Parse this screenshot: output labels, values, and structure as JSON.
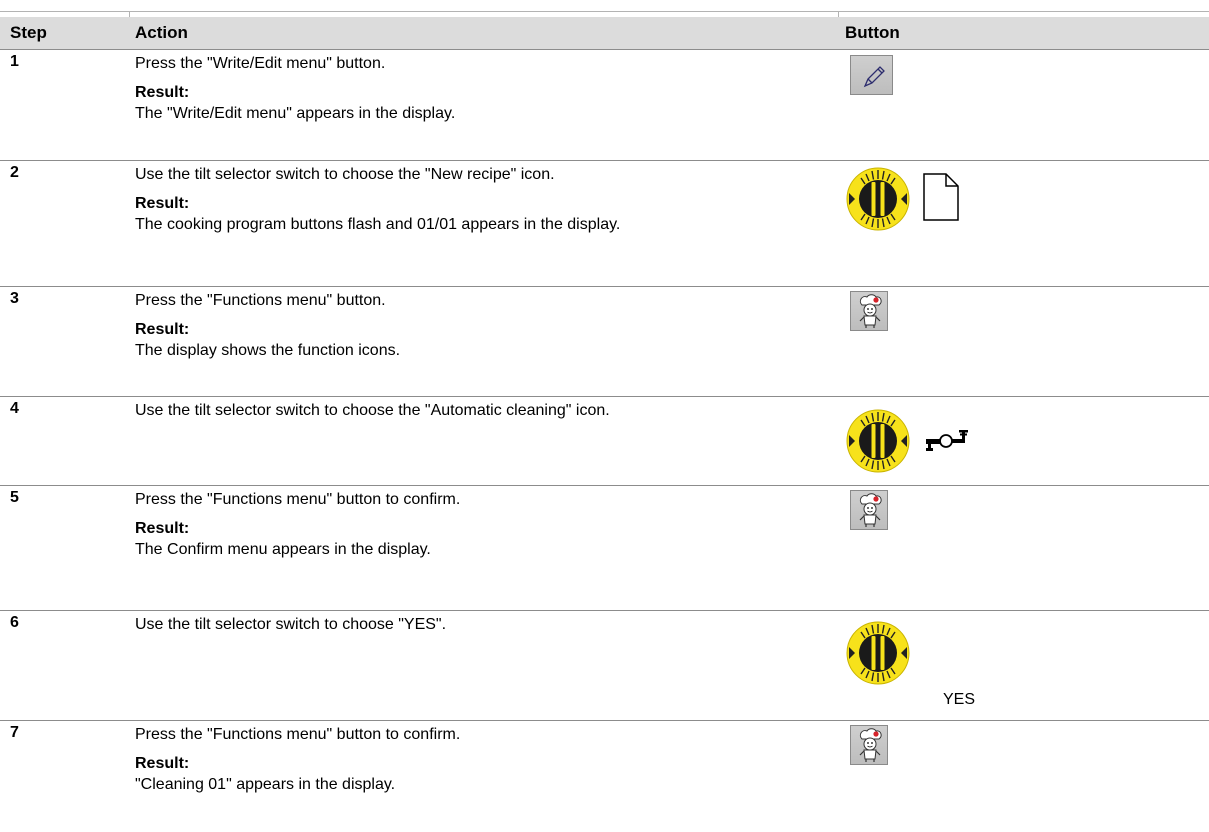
{
  "table": {
    "headers": {
      "step": "Step",
      "action": "Action",
      "button": "Button"
    },
    "rows": [
      {
        "step": "1",
        "action": "Press the \"Write/Edit menu\" button.",
        "result_label": "Result:",
        "result": "The \"Write/Edit menu\" appears in the display.",
        "icons": [
          "pencil-icon"
        ]
      },
      {
        "step": "2",
        "action": "Use the tilt selector switch to choose the \"New recipe\" icon.",
        "result_label": "Result:",
        "result": "The cooking program buttons flash and 01/01 appears in the display.",
        "icons": [
          "tilt-selector-icon",
          "new-recipe-icon"
        ]
      },
      {
        "step": "3",
        "action": "Press the \"Functions menu\" button.",
        "result_label": "Result:",
        "result": "The display shows the function icons.",
        "icons": [
          "chef-icon"
        ]
      },
      {
        "step": "4",
        "action": "Use the tilt selector switch to choose the \"Automatic cleaning\" icon.",
        "icons": [
          "tilt-selector-icon",
          "automatic-cleaning-icon"
        ]
      },
      {
        "step": "5",
        "action": "Press the \"Functions menu\" button to confirm.",
        "result_label": "Result:",
        "result": "The Confirm menu appears in the display.",
        "icons": [
          "chef-icon"
        ]
      },
      {
        "step": "6",
        "action": "Use the tilt selector switch to choose \"YES\".",
        "button_text": "YES",
        "icons": [
          "tilt-selector-icon"
        ]
      },
      {
        "step": "7",
        "action": "Press the \"Functions menu\" button to confirm.",
        "result_label": "Result:",
        "result": "\"Cleaning 01\" appears in the display.",
        "icons": [
          "chef-icon"
        ]
      }
    ]
  },
  "colors": {
    "header_bg": "#dcdcdc",
    "rule": "#8c8c8c",
    "knob_yellow": "#f7e21b",
    "chef_badge_red": "#d6232a"
  }
}
